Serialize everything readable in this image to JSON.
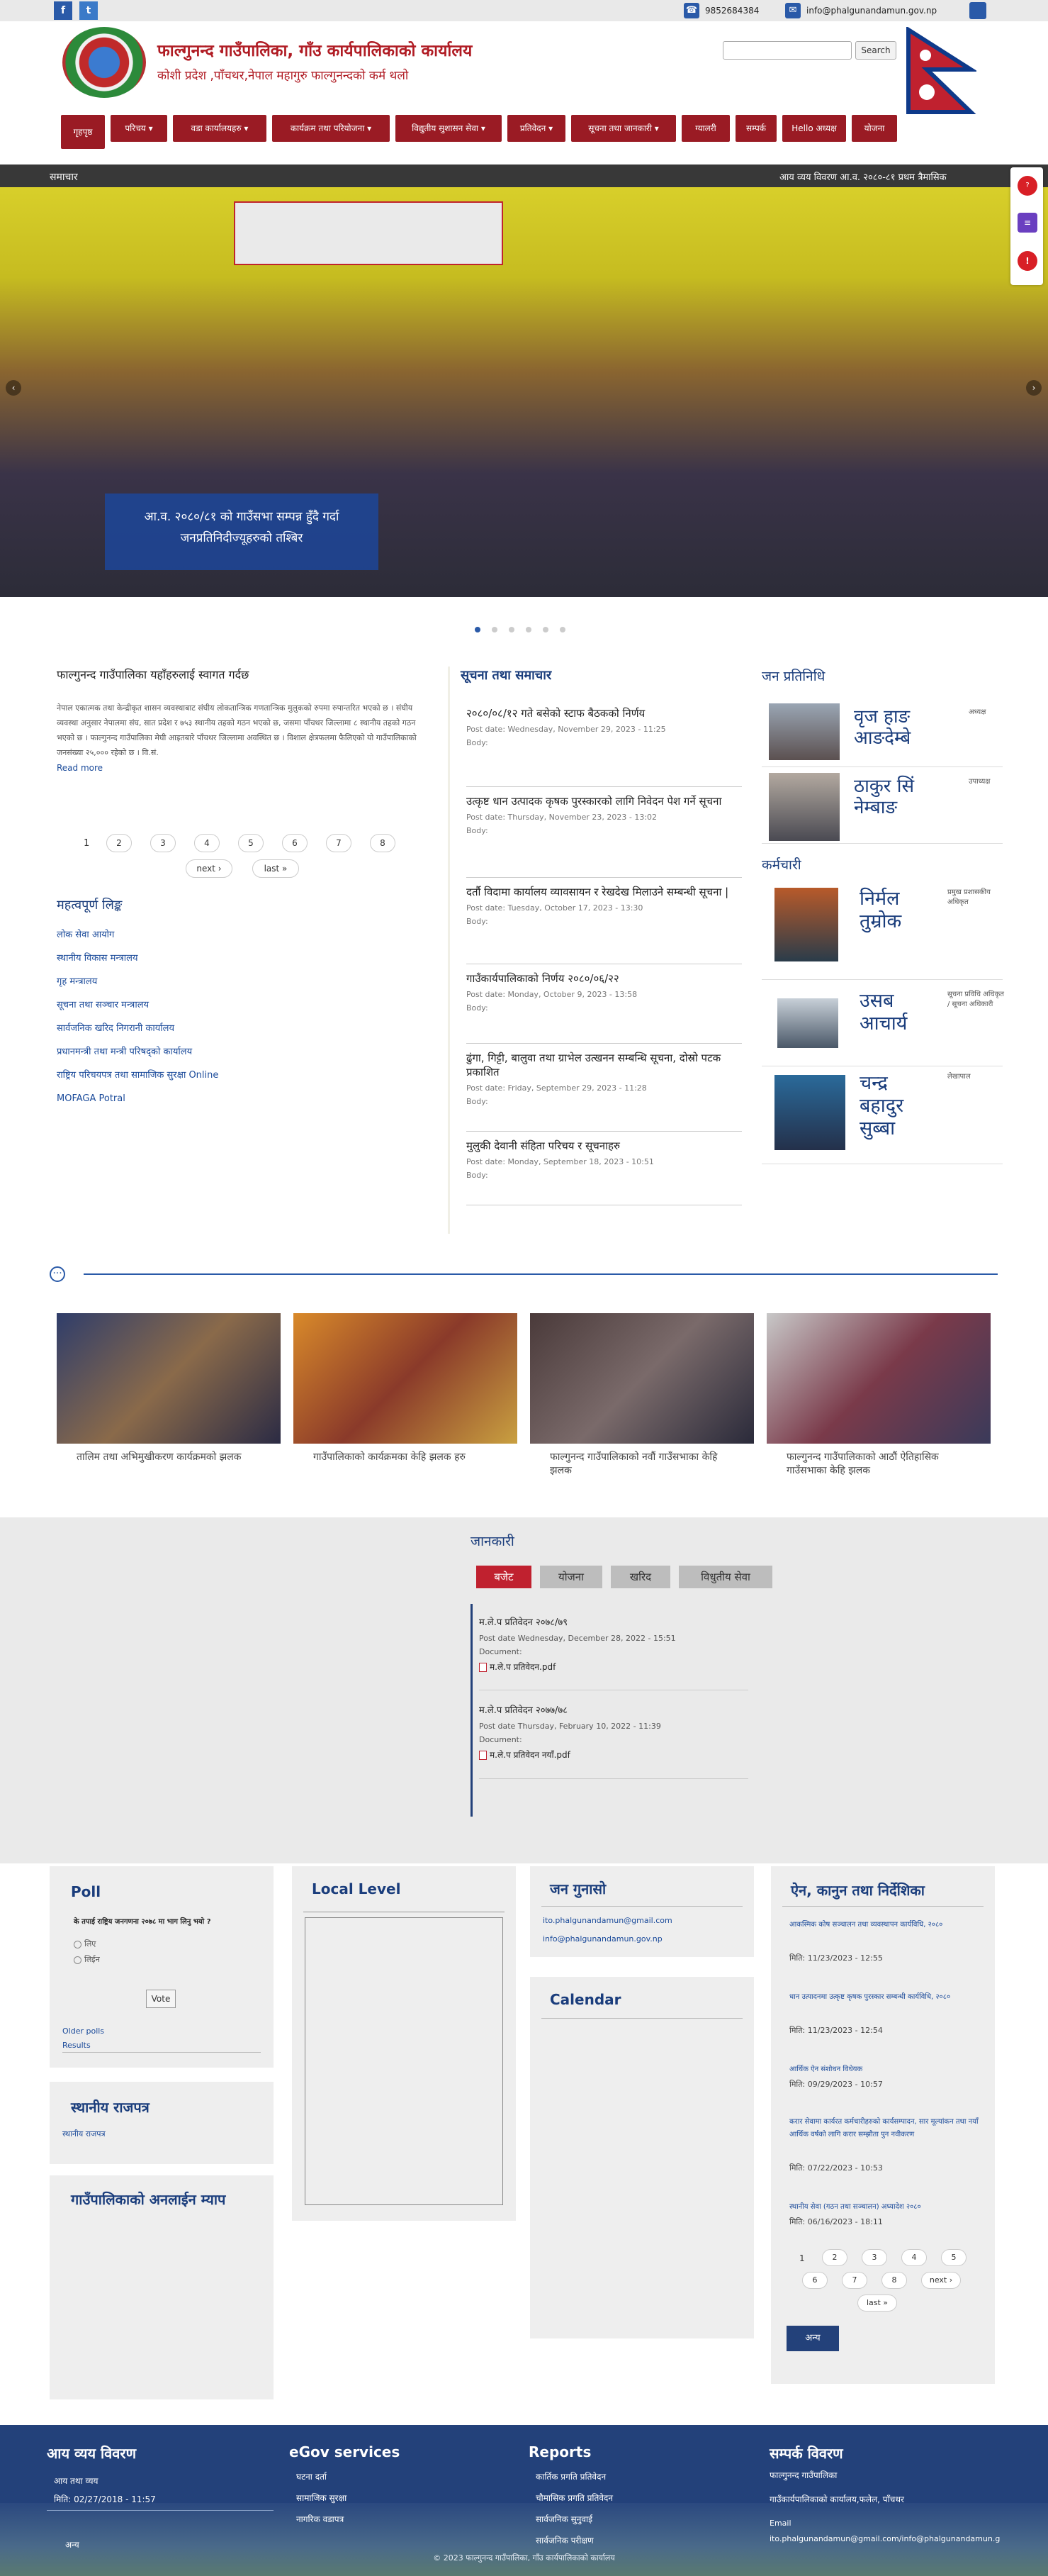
{
  "topbar": {
    "facebook_icon": "f",
    "twitter_icon": "t",
    "phone": "9852684384",
    "email": "info@phalgunandamun.gov.np"
  },
  "header": {
    "title": "फाल्गुनन्द गाउँपालिका, गाँउ कार्यपालिकाको कार्यालय",
    "subtitle": "कोशी प्रदेश ,पाँचथर,नेपाल महागुरु फाल्गुनन्दको कर्म थलो",
    "search_placeholder": "",
    "search_button": "Search"
  },
  "nav": [
    "गृहपृष्ठ",
    "परिचय",
    "वडा कार्यालयहरु",
    "कार्यक्रम तथा परियोजना",
    "विद्युतीय सुशासन सेवा",
    "प्रतिवेदन",
    "सूचना तथा जानकारी",
    "ग्यालरी",
    "सम्पर्क",
    "Hello अध्यक्ष",
    "योजना"
  ],
  "newsbar": {
    "label": "समाचार",
    "ticker": "आय व्यय विवरण आ.व. २०८०-८१ प्रथम त्रैमासिक"
  },
  "slider": {
    "caption": "आ.व. २०८०/८१ को गाउँसभा सम्पन्न हुँदै गर्दा जनप्रतिनिदीज्यूहरुको तश्बिर"
  },
  "welcome": {
    "title": "फाल्गुनन्द गाउँपालिका यहाँहरुलाई स्वागत गर्दछ",
    "body": "नेपाल एकात्मक तथा केन्द्रीकृत शासन व्यवस्थाबाट संघीय लोकतान्त्रिक गणतान्त्रिक मुलुकको रुपमा रुपान्तरित भएको छ । संघीय व्यवस्था अनुसार नेपालमा संघ, सात प्रदेश र ७५३ स्थानीय तहको गठन भएको छ, जसमा पाँचथर जिल्लामा ८ स्थानीय तहको गठन भएको छ । फाल्गुनन्द गाउँपालिका मेघी आइतबारे पाँचथर जिल्लामा अवस्थित छ । विशाल क्षेत्रफलमा फैलिएको यो गाउँपालिकाको जनसंख्या २५,००० रहेको छ । वि.सं.",
    "read_more": "Read more",
    "pager": [
      "1",
      "2",
      "3",
      "4",
      "5",
      "6",
      "7",
      "8"
    ],
    "pager_next": "next ›",
    "pager_last": "last »"
  },
  "links": {
    "title": "महत्वपूर्ण लिङ्क",
    "items": [
      "लोक सेवा आयोग",
      "स्थानीय विकास मन्त्रालय",
      "गृह मन्त्रालय",
      "सूचना तथा सञ्चार मन्त्रालय",
      "सार्वजनिक खरिद निगरानी कार्यालय",
      "प्रधानमन्त्री तथा मन्त्री परिषद्को कार्यालय",
      "राष्ट्रिय परिचयपत्र तथा सामाजिक सुरक्षा Online",
      "MOFAGA Potral"
    ]
  },
  "news": {
    "title": "सूचना तथा समाचार",
    "items": [
      {
        "title": "२०८०/०८/१२ गते बसेको स्टाफ बैठकको निर्णय",
        "date": "Post date: Wednesday, November 29, 2023 - 11:25",
        "body": "Body:"
      },
      {
        "title": "उत्कृष्ट धान उत्पादक कृषक पुरस्कारको लागि निवेदन पेश गर्ने सूचना",
        "date": "Post date: Thursday, November 23, 2023 - 13:02",
        "body": "Body:"
      },
      {
        "title": "दर्तौ विदामा कार्यालय व्यावसायन र रेखदेख मिलाउने सम्बन्धी सूचना |",
        "date": "Post date: Tuesday, October 17, 2023 - 13:30",
        "body": "Body:"
      },
      {
        "title": "गाउँकार्यपालिकाको निर्णय २०८०/०६/२२",
        "date": "Post date: Monday, October 9, 2023 - 13:58",
        "body": "Body:"
      },
      {
        "title": "ढुंगा, गिट्टी, बालुवा तथा ग्राभेल उत्खनन सम्बन्धि सूचना, दोस्रो पटक प्रकाशित",
        "date": "Post date: Friday, September 29, 2023 - 11:28",
        "body": "Body:"
      },
      {
        "title": "मुलुकी देवानी संहिता परिचय र सूचनाहरु",
        "date": "Post date: Monday, September 18, 2023 - 10:51",
        "body": "Body:"
      }
    ]
  },
  "reps": {
    "title": "जन प्रतिनिधि",
    "items": [
      {
        "name": "वृज हाङ आङदेम्बे",
        "role": "अध्यक्ष"
      },
      {
        "name": "ठाकुर सिं नेम्बाङ",
        "role": "उपाध्यक्ष"
      }
    ]
  },
  "staff": {
    "title": "कर्मचारी",
    "items": [
      {
        "name": "निर्मल तुम्रोक",
        "role": "प्रमुख प्रशासकीय अधिकृत"
      },
      {
        "name": "उसब आचार्य",
        "role": "सूचना प्रविधि अधिकृत / सूचना अधिकारी"
      },
      {
        "name": "चन्द्र बहादुर सुब्बा",
        "role": "लेखापाल"
      }
    ]
  },
  "gallery": [
    {
      "caption": "तालिम तथा अभिमुखीकरण कार्यक्रमको झलक"
    },
    {
      "caption": "गाउँपालिकाको कार्यक्रमका केहि झलक हरु"
    },
    {
      "caption": "फाल्गुनन्द गाउँपालिकाको नवौं गाउँसभाका केहि झलक"
    },
    {
      "caption": "फाल्गुनन्द गाउँपालिकाको आठौं ऐतिहासिक गाउँसभाका केहि झलक"
    }
  ],
  "info": {
    "title": "जानकारी",
    "tabs": [
      "बजेट",
      "योजना",
      "खरिद",
      "विधुतीय सेवा"
    ],
    "items": [
      {
        "title": "म.ले.प प्रतिवेदन २०७८/७९",
        "date": "Post date Wednesday, December 28, 2022 - 15:51",
        "doc_label": "Document:",
        "file": "म.ले.प प्रतिवेदन.pdf"
      },
      {
        "title": "म.ले.प प्रतिवेदन २०७७/७८",
        "date": "Post date Thursday, February 10, 2022 - 11:39",
        "doc_label": "Document:",
        "file": "म.ले.प प्रतिवेदन नयाँ.pdf"
      }
    ]
  },
  "poll": {
    "title": "Poll",
    "question": "के तपाई राष्ट्रिय जनगणना २०७८ मा भाग लिनु भयो ?",
    "options": [
      "लिए",
      "लिईन"
    ],
    "vote": "Vote",
    "older": "Older polls",
    "results": "Results"
  },
  "gazette": {
    "title": "स्थानीय राजपत्र",
    "link": "स्थानीय राजपत्र"
  },
  "online_map": {
    "title": "गाउँपालिकाको अनलाईन म्याप"
  },
  "local_level": {
    "title": "Local Level"
  },
  "complaints": {
    "title": "जन गुनासो",
    "links": [
      "ito.phalgunandamun@gmail.com",
      "info@phalgunandamun.gov.np"
    ]
  },
  "calendar": {
    "title": "Calendar"
  },
  "laws": {
    "title": "ऐन, कानुन तथा निर्देशिका",
    "items": [
      {
        "title": "आकस्मिक कोष सञ्चालन तथा व्यवस्थापन कार्यविधि, २०८०",
        "date": "मिति: 11/23/2023 - 12:55"
      },
      {
        "title": "धान उत्पादनमा उत्कृष्ट कृषक पुरस्कार सम्बन्धी कार्यविधि, २०८०",
        "date": "मिति: 11/23/2023 - 12:54"
      },
      {
        "title": "आर्थिक ऐन संशोधन विधेयक",
        "date": "मिति: 09/29/2023 - 10:57"
      },
      {
        "title": "करार सेवामा कार्यरत कर्मचारीहरुको कार्यसम्पादन, सार मूल्यांकन तथा नयाँ आर्थिक वर्षको लागि करार सम्झौता पुन नवीकरण",
        "date": "मिति: 07/22/2023 - 10:53"
      },
      {
        "title": "स्थानीय सेवा (गठन तथा सञ्चालन) अध्यादेश २०८०",
        "date": "मिति: 06/16/2023 - 18:11"
      }
    ],
    "pager": [
      "1",
      "2",
      "3",
      "4",
      "5",
      "6",
      "7",
      "8"
    ],
    "pager_next": "next ›",
    "pager_last": "last »",
    "more": "अन्य"
  },
  "footer": {
    "income": {
      "title": "आय व्यय विवरण",
      "link": "आय तथा व्यय",
      "date": "मिति: 02/27/2018 - 11:57",
      "more": "अन्य"
    },
    "egov": {
      "title": "eGov services",
      "items": [
        "घटना दर्ता",
        "सामाजिक सुरक्षा",
        "नागरिक वडापत्र"
      ]
    },
    "reports": {
      "title": "Reports",
      "items": [
        "कार्तिक प्रगति प्रतिवेदन",
        "चौमासिक प्रगति प्रतिवेदन",
        "सार्वजनिक सुनुवाई",
        "सार्वजनिक परीक्षण"
      ]
    },
    "contact": {
      "title": "सम्पर्क विवरण",
      "name": "फाल्गुनन्द गाउँपालिका",
      "address": "गाउँकार्यपालिकाको कार्यालय,फलेल, पाँचथर",
      "email_label": "Email",
      "emails": "ito.phalgunandamun@gmail.com/info@phalgunandamun.g"
    },
    "copyright": "© 2023 फाल्गुनन्द गाउँपालिका, गाँउ कार्यपालिकाको कार्यालय"
  },
  "side_icons": [
    "faq-icon",
    "chat-icon",
    "alert-icon"
  ]
}
